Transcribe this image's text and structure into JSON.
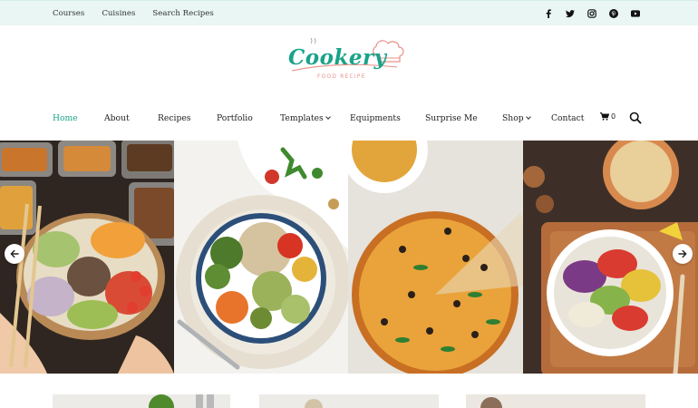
{
  "topbar": {
    "links": [
      {
        "label": "Courses"
      },
      {
        "label": "Cuisines"
      },
      {
        "label": "Search Recipes"
      }
    ],
    "social": [
      {
        "icon": "facebook-icon",
        "glyph": "f"
      },
      {
        "icon": "twitter-icon",
        "glyph": "t"
      },
      {
        "icon": "instagram-icon",
        "glyph": "◎"
      },
      {
        "icon": "pinterest-icon",
        "glyph": "p"
      },
      {
        "icon": "youtube-icon",
        "glyph": "▶"
      }
    ]
  },
  "logo": {
    "name": "Cookery",
    "tagline": "FOOD RECIPE"
  },
  "nav": {
    "items": [
      {
        "label": "Home",
        "active": true
      },
      {
        "label": "About"
      },
      {
        "label": "Recipes"
      },
      {
        "label": "Portfolio"
      },
      {
        "label": "Templates",
        "dropdown": true
      },
      {
        "label": "Equipments"
      },
      {
        "label": "Surprise Me"
      },
      {
        "label": "Shop",
        "dropdown": true
      },
      {
        "label": "Contact"
      }
    ],
    "cart_count": "0"
  },
  "slider": {
    "slides": [
      {
        "name": "poke-bowl-slide"
      },
      {
        "name": "roasted-vegetable-bowl-slide"
      },
      {
        "name": "pizza-slide"
      },
      {
        "name": "salad-bowl-slide"
      }
    ]
  },
  "colors": {
    "accent": "#1aa389",
    "topbar_bg": "#e9f6f3",
    "tagline": "#e88f88"
  }
}
